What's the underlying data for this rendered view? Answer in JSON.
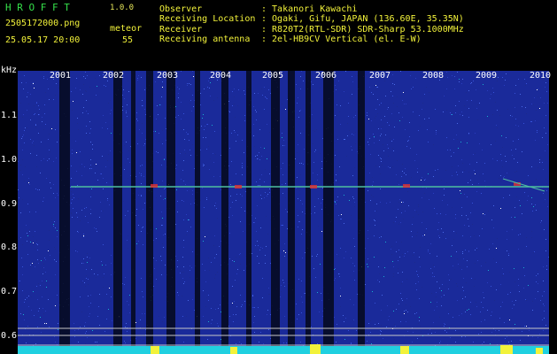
{
  "header": {
    "app_name": "H R O F F T",
    "version": "1.0.0",
    "filename": "2505172000.png",
    "datetime": "25.05.17 20:00",
    "meteor_label": "meteor",
    "meteor_count": "55"
  },
  "info": {
    "rows": [
      {
        "label": "Observer",
        "value": ": Takanori Kawachi"
      },
      {
        "label": "Receiving Location",
        "value": ": Ogaki, Gifu, JAPAN (136.60E, 35.35N)"
      },
      {
        "label": "Receiver",
        "value": ": R820T2(RTL-SDR) SDR-Sharp 53.1000MHz"
      },
      {
        "label": "Receiving antenna",
        "value": ": 2el-HB9CV Vertical (el. E-W)"
      }
    ]
  },
  "axis": {
    "unit": "kHz",
    "y_ticks": [
      "1.1",
      "1.0",
      "0.9",
      "0.8",
      "0.7",
      "0.6"
    ],
    "x_ticks": [
      "2001",
      "2002",
      "2003",
      "2004",
      "2005",
      "2006",
      "2007",
      "2008",
      "2009",
      "2010"
    ]
  },
  "colors": {
    "background": "#000000",
    "noise_blue": "#1a2a9a",
    "signal_green": "#4ec0a0",
    "meteor_red": "#e03030",
    "level_yellow": "#f2f23a",
    "level_cyan": "#20d0e0"
  }
}
